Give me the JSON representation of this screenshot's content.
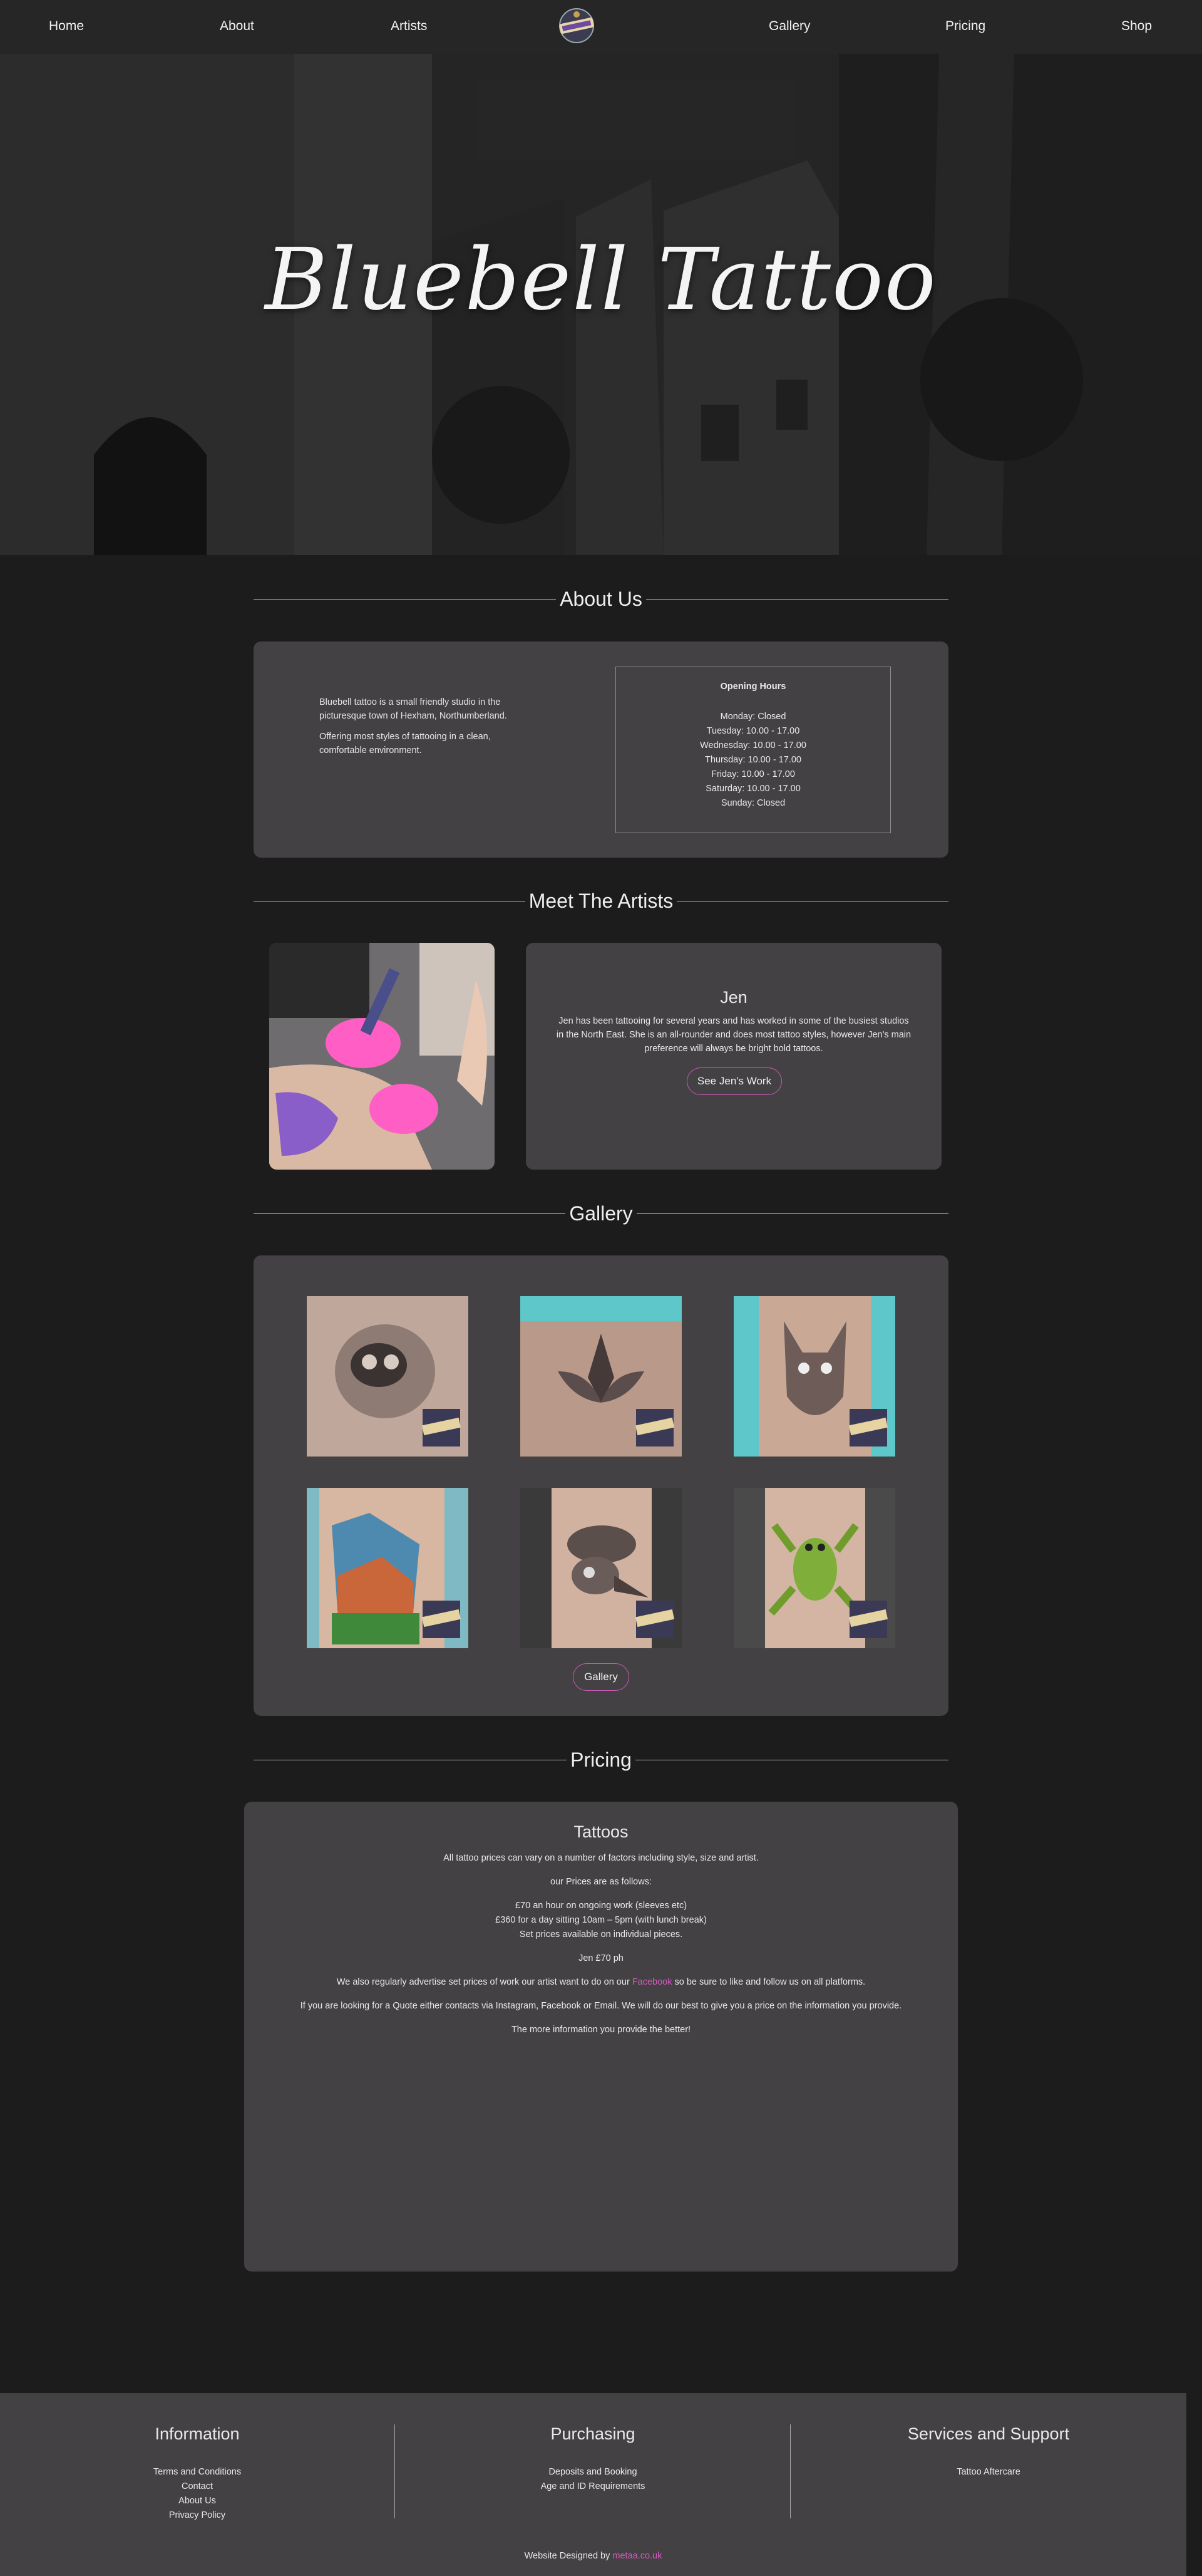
{
  "nav": {
    "links": [
      "Home",
      "About",
      "Artists",
      "Gallery",
      "Pricing",
      "Shop"
    ]
  },
  "hero": {
    "title": "Bluebell Tattoo"
  },
  "about": {
    "heading": "About Us",
    "paragraphs": [
      "Bluebell tattoo is a small friendly studio in the picturesque town of Hexham, Northumberland.",
      "Offering most styles of tattooing in a clean, comfortable environment."
    ],
    "hours_title": "Opening Hours",
    "hours": [
      "Monday: Closed",
      "Tuesday: 10.00 - 17.00",
      "Wednesday: 10.00 - 17.00",
      "Thursday: 10.00 - 17.00",
      "Friday: 10.00 - 17.00",
      "Saturday: 10.00 - 17.00",
      "Sunday: Closed"
    ]
  },
  "artists": {
    "heading": "Meet The Artists",
    "name": "Jen",
    "description": "Jen has been tattooing for several years and has worked in some of the busiest studios in the North East. She is an all-rounder and does most tattoo styles, however Jen's main preference will always be bright bold tattoos.",
    "button": "See Jen's Work"
  },
  "gallery": {
    "heading": "Gallery",
    "button": "Gallery"
  },
  "pricing": {
    "heading": "Pricing",
    "title": "Tattoos",
    "intro": "All tattoo prices can vary on a number of factors including style, size and artist.",
    "as_follows": "our Prices are as follows:",
    "list": [
      "£70 an hour on ongoing work (sleeves etc)",
      "£360 for a day sitting 10am – 5pm (with lunch break)",
      "Set prices available on individual pieces."
    ],
    "jen_rate": "Jen £70 ph",
    "advertise_pre": "We also regularly advertise set prices of work our artist want to do on our ",
    "advertise_link": "Facebook",
    "advertise_post": " so be sure to like and follow us on all platforms.",
    "quote": "If you are looking for a Quote either contacts via Instagram, Facebook or Email. We will do our best to give you a price on the information you provide.",
    "more": "The more information you provide the better!"
  },
  "footer": {
    "information": {
      "heading": "Information",
      "links": [
        "Terms and Conditions",
        "Contact",
        "About Us",
        "Privacy Policy"
      ]
    },
    "purchasing": {
      "heading": "Purchasing",
      "links": [
        "Deposits and Booking",
        "Age and ID Requirements"
      ]
    },
    "support": {
      "heading": "Services and Support",
      "links": [
        "Tattoo Aftercare"
      ]
    },
    "credit_pre": "Website Designed by ",
    "credit_link": "metaa.co.uk"
  },
  "colors": {
    "accent": "#d65ac0",
    "card": "#434143",
    "background": "#1c1c1c"
  }
}
